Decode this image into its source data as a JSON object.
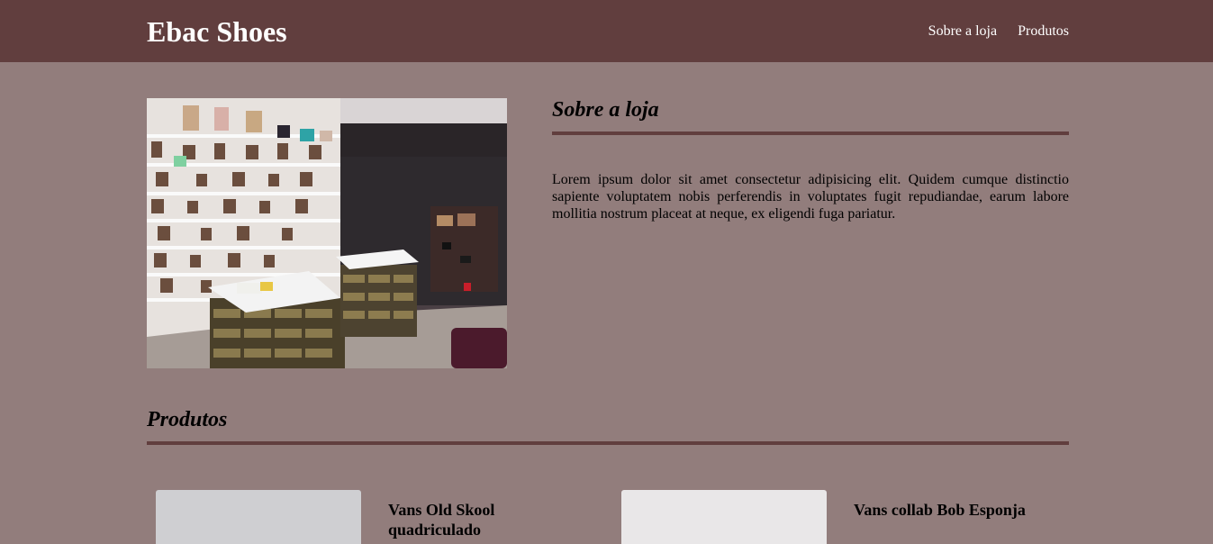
{
  "header": {
    "brand": "Ebac Shoes",
    "nav": [
      "Sobre a loja",
      "Produtos"
    ]
  },
  "about": {
    "title": "Sobre a loja",
    "text": "Lorem ipsum dolor sit amet consectetur adipisicing elit. Quidem cumque distinctio sapiente voluptatem nobis perferendis in voluptates fugit repudiandae, earum labore mollitia nostrum placeat at neque, ex eligendi fuga pariatur."
  },
  "products": {
    "title": "Produtos",
    "items": [
      {
        "name": "Vans Old Skool quadriculado"
      },
      {
        "name": "Vans collab Bob Esponja"
      }
    ]
  },
  "colors": {
    "header_bg": "#613e3e",
    "page_bg": "#927d7c",
    "rule": "#613e3e"
  }
}
